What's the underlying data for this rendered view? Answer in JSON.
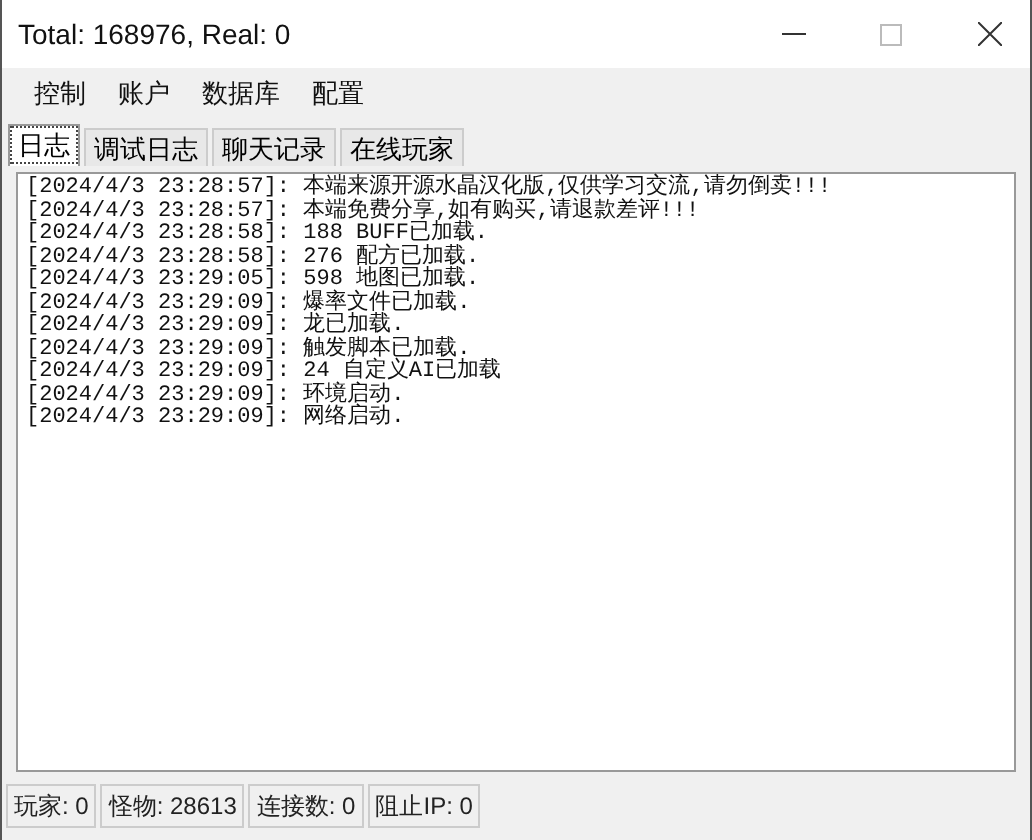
{
  "window": {
    "title": "Total: 168976, Real: 0"
  },
  "menu": [
    "控制",
    "账户",
    "数据库",
    "配置"
  ],
  "tabs": [
    {
      "label": "日志",
      "selected": true
    },
    {
      "label": "调试日志",
      "selected": false
    },
    {
      "label": "聊天记录",
      "selected": false
    },
    {
      "label": "在线玩家",
      "selected": false
    }
  ],
  "log": [
    "[2024/4/3 23:28:57]: 本端来源开源水晶汉化版,仅供学习交流,请勿倒卖!!!",
    "[2024/4/3 23:28:57]: 本端免费分享,如有购买,请退款差评!!!",
    "[2024/4/3 23:28:58]: 188 BUFF已加载.",
    "[2024/4/3 23:28:58]: 276 配方已加载.",
    "[2024/4/3 23:29:05]: 598 地图已加载.",
    "[2024/4/3 23:29:09]: 爆率文件已加载.",
    "[2024/4/3 23:29:09]: 龙已加载.",
    "[2024/4/3 23:29:09]: 触发脚本已加载.",
    "[2024/4/3 23:29:09]: 24 自定义AI已加载",
    "[2024/4/3 23:29:09]: 环境启动.",
    "[2024/4/3 23:29:09]: 网络启动."
  ],
  "status_bar": [
    "玩家: 0",
    "怪物: 28613",
    "连接数: 0",
    "阻止IP: 0"
  ]
}
